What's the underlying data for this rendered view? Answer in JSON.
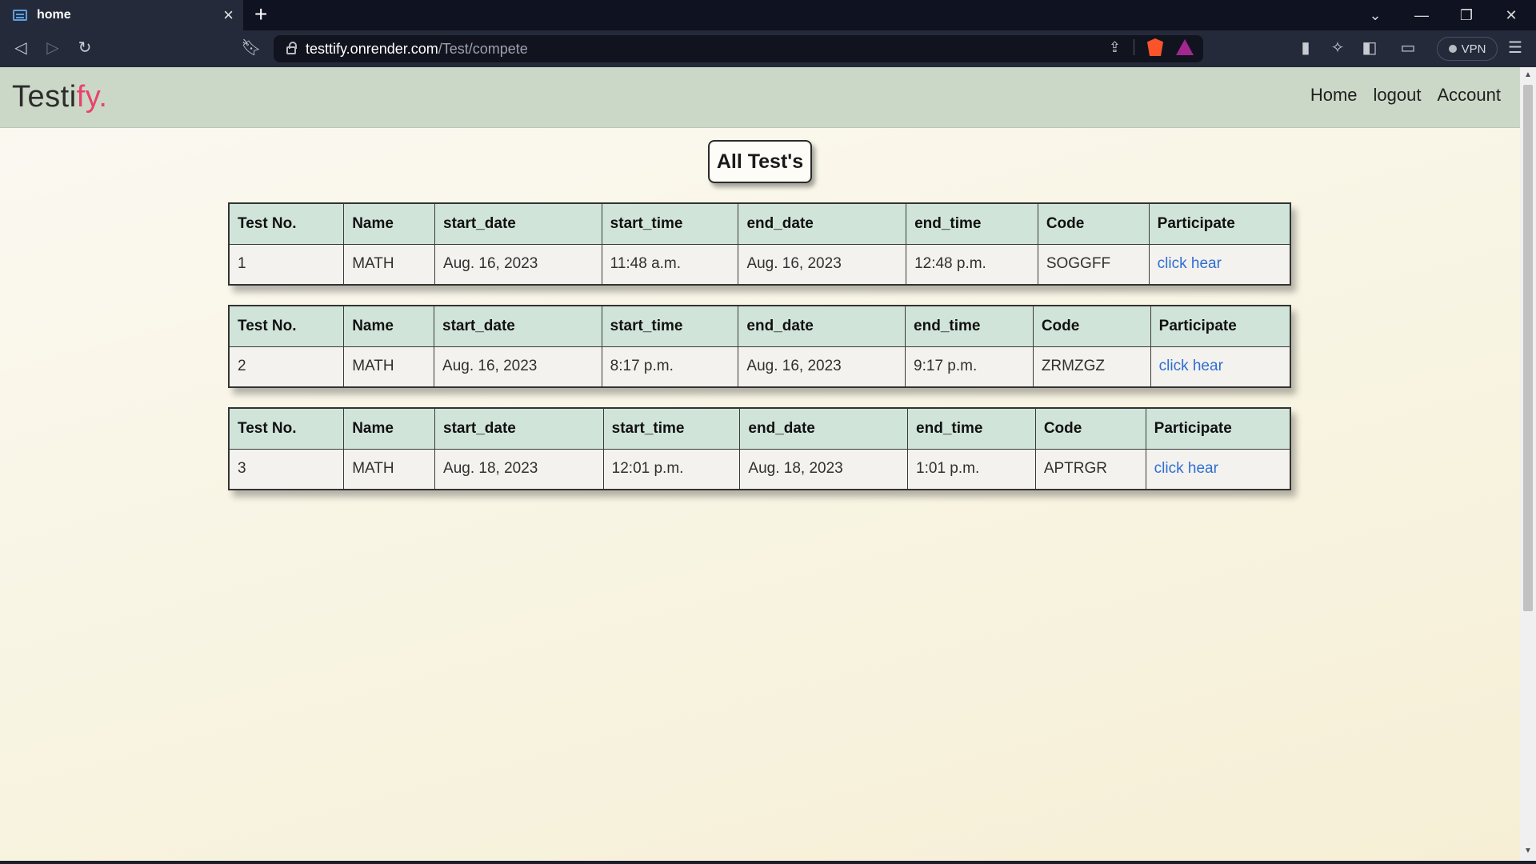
{
  "browser": {
    "tab_title": "home",
    "tab_close": "×",
    "new_tab": "+",
    "url_host": "testtify.onrender.com",
    "url_path": "/Test/compete",
    "vpn_label": "VPN"
  },
  "navbar": {
    "brand_main": "Testi",
    "brand_accent": "fy.",
    "links": [
      "Home",
      "logout",
      "Account"
    ]
  },
  "page": {
    "title": "All Test's"
  },
  "table_headers": [
    "Test No.",
    "Name",
    "start_date",
    "start_time",
    "end_date",
    "end_time",
    "Code",
    "Participate"
  ],
  "tests": [
    {
      "no": "1",
      "name": "MATH",
      "start_date": "Aug. 16, 2023",
      "start_time": "11:48 a.m.",
      "end_date": "Aug. 16, 2023",
      "end_time": "12:48 p.m.",
      "code": "SOGGFF",
      "participate": "click hear"
    },
    {
      "no": "2",
      "name": "MATH",
      "start_date": "Aug. 16, 2023",
      "start_time": "8:17 p.m.",
      "end_date": "Aug. 16, 2023",
      "end_time": "9:17 p.m.",
      "code": "ZRMZGZ",
      "participate": "click hear"
    },
    {
      "no": "3",
      "name": "MATH",
      "start_date": "Aug. 18, 2023",
      "start_time": "12:01 p.m.",
      "end_date": "Aug. 18, 2023",
      "end_time": "1:01 p.m.",
      "code": "APTRGR",
      "participate": "click hear"
    }
  ],
  "colors": {
    "navbar_bg": "#cbd8c8",
    "brand_accent": "#e8436b",
    "header_cell_bg": "#d1e4da",
    "link": "#2f6dd1"
  }
}
